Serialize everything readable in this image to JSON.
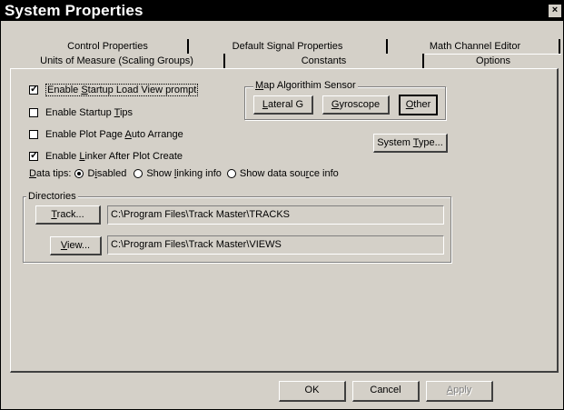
{
  "window": {
    "title": "System Properties",
    "close_label": "×"
  },
  "tabs": {
    "back_row": [
      "Control Properties",
      "Default Signal Properties",
      "Math Channel Editor"
    ],
    "front_row": [
      "Units of Measure (Scaling Groups)",
      "Constants",
      "Options"
    ],
    "active": "Options"
  },
  "options": {
    "startup_load_view": {
      "pre": "Enable ",
      "key": "S",
      "post": "tartup Load View prompt",
      "checked": true
    },
    "startup_tips": {
      "pre": "Enable Startup ",
      "key": "T",
      "post": "ips",
      "checked": false
    },
    "auto_arrange": {
      "pre": "Enable Plot Page ",
      "key": "A",
      "post": "uto Arrange",
      "checked": false
    },
    "linker": {
      "pre": "Enable ",
      "key": "L",
      "post": "inker After Plot Create",
      "checked": true
    },
    "check_mark": "✓"
  },
  "data_tips": {
    "label_key": "D",
    "label_post": "ata tips:",
    "disabled": {
      "pre": "D",
      "key": "i",
      "post": "sabled",
      "selected": true
    },
    "linking": {
      "pre": "Show ",
      "key": "l",
      "post": "inking info",
      "selected": false
    },
    "source": {
      "pre": "Show data sou",
      "key": "r",
      "post": "ce info",
      "selected": false
    }
  },
  "map_algorithm": {
    "label_key": "M",
    "label_post": "ap Algorithim Sensor",
    "lateral": {
      "key": "L",
      "post": "ateral G"
    },
    "gyro": {
      "key": "G",
      "post": "yroscope"
    },
    "other": {
      "key": "O",
      "post": "ther"
    }
  },
  "system_type": {
    "pre": "System ",
    "key": "T",
    "post": "ype..."
  },
  "directories": {
    "label": "Directories",
    "track": {
      "key": "T",
      "post": "rack...",
      "path": "C:\\Program Files\\Track Master\\TRACKS"
    },
    "view": {
      "key": "V",
      "post": "iew...",
      "path": "C:\\Program Files\\Track Master\\VIEWS"
    }
  },
  "footer": {
    "ok": "OK",
    "cancel": "Cancel",
    "apply_key": "A",
    "apply_post": "pply"
  }
}
